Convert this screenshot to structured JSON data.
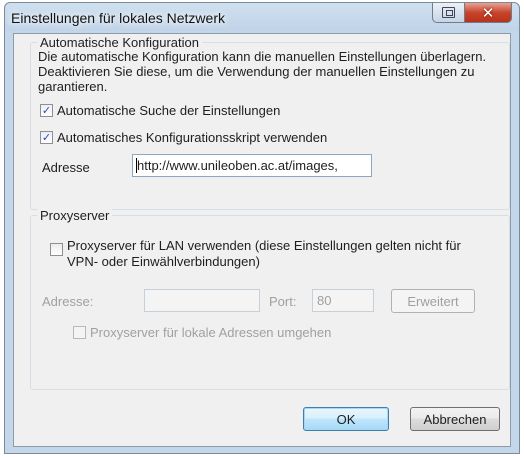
{
  "window": {
    "title": "Einstellungen für lokales Netzwerk"
  },
  "auto_config": {
    "legend": "Automatische Konfiguration",
    "description": "Die automatische Konfiguration kann die manuellen Einstellungen überlagern. Deaktivieren Sie diese, um die Verwendung der manuellen Einstellungen zu garantieren.",
    "auto_detect": {
      "label": "Automatische Suche der Einstellungen",
      "checked": true
    },
    "auto_script": {
      "label": "Automatisches Konfigurationsskript verwenden",
      "checked": true
    },
    "address_label": "Adresse",
    "address_value": "http://www.unileoben.ac.at/images,"
  },
  "proxy": {
    "legend": "Proxyserver",
    "use_proxy": {
      "label": "Proxyserver für LAN verwenden (diese Einstellungen gelten nicht für VPN- oder Einwählverbindungen)",
      "checked": false
    },
    "address_label": "Adresse:",
    "address_value": "",
    "port_label": "Port:",
    "port_value": "80",
    "advanced_label": "Erweitert",
    "bypass": {
      "label": "Proxyserver für lokale Adressen umgehen",
      "checked": false
    }
  },
  "buttons": {
    "ok": "OK",
    "cancel": "Abbrechen"
  },
  "icons": {
    "help": "window-help-icon",
    "close": "window-close-icon",
    "check": "checkmark-icon"
  }
}
